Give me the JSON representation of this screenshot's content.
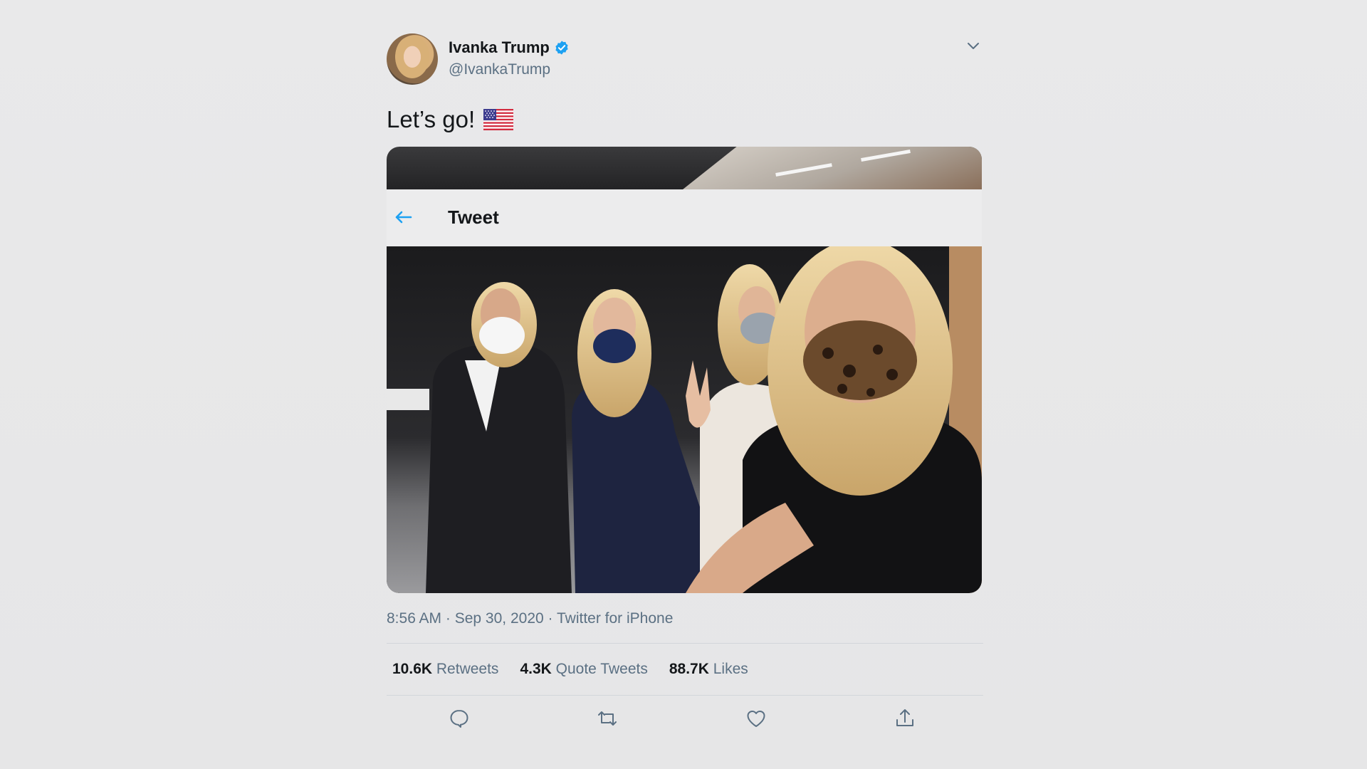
{
  "user": {
    "display_name": "Ivanka Trump",
    "handle": "@IvankaTrump",
    "verified": true
  },
  "tweet": {
    "text": "Let’s go!",
    "emoji": "us-flag-icon"
  },
  "media": {
    "embedded_header_title": "Tweet",
    "embedded_back_icon": "back-arrow-icon",
    "photo_description": ""
  },
  "meta": {
    "time": "8:56 AM",
    "date": "Sep 30, 2020",
    "source": "Twitter for iPhone",
    "separator": " · "
  },
  "stats": [
    {
      "num": "10.6K",
      "label": "Retweets"
    },
    {
      "num": "4.3K",
      "label": "Quote Tweets"
    },
    {
      "num": "88.7K",
      "label": "Likes"
    }
  ],
  "actions": [
    {
      "name": "reply-icon"
    },
    {
      "name": "retweet-icon"
    },
    {
      "name": "like-icon"
    },
    {
      "name": "share-icon"
    }
  ],
  "colors": {
    "background": "#e8e8e9",
    "text": "#14171a",
    "secondary_text": "#5b7083",
    "accent": "#1da1f2",
    "divider": "#d2d6da"
  }
}
